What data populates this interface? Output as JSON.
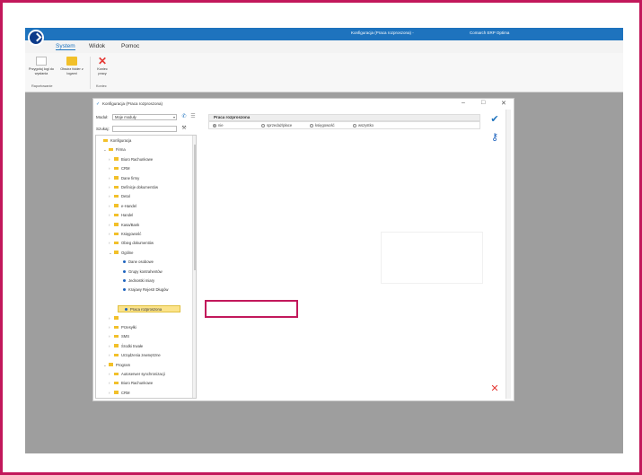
{
  "window": {
    "title": "Konfiguracja (Praca rozproszona) -",
    "app_name": "Comarch ERP Optima"
  },
  "ribbon": {
    "tabs": [
      {
        "label": "System",
        "active": true
      },
      {
        "label": "Widok",
        "active": false
      },
      {
        "label": "Pomoc",
        "active": false
      }
    ],
    "buttons": [
      {
        "label": "Przygotuj logi do wysłania",
        "icon": "document-icon"
      },
      {
        "label": "Otwórz folder z logami",
        "icon": "folder-icon"
      },
      {
        "label": "Koniec pracy",
        "icon": "close-icon"
      }
    ],
    "groups": [
      "Raportowanie",
      "Koniec"
    ]
  },
  "dialog": {
    "title": "Konfiguracja (Praca rozproszona)",
    "module_label": "Moduł:",
    "module_value": "Moje moduły",
    "search_label": "Szukaj:",
    "panel_title": "Praca rozproszona",
    "radio_options": [
      {
        "label": "nie",
        "selected": true
      },
      {
        "label": "sprzedaż/płace",
        "selected": false
      },
      {
        "label": "księgowość",
        "selected": false
      },
      {
        "label": "wszystko",
        "selected": false
      }
    ],
    "tree": [
      {
        "label": "Konfiguracja",
        "level": 0,
        "chev": "",
        "kind": "folder"
      },
      {
        "label": "Firma",
        "level": 1,
        "chev": "v",
        "kind": "folder"
      },
      {
        "label": "Biuro Rachunkowe",
        "level": 2,
        "chev": ">",
        "kind": "folder"
      },
      {
        "label": "CRM",
        "level": 2,
        "chev": ">",
        "kind": "folder"
      },
      {
        "label": "Dane firmy",
        "level": 2,
        "chev": ">",
        "kind": "folder"
      },
      {
        "label": "Definicje dokumentów",
        "level": 2,
        "chev": ">",
        "kind": "folder"
      },
      {
        "label": "Detal",
        "level": 2,
        "chev": ">",
        "kind": "folder"
      },
      {
        "label": "e-Handel",
        "level": 2,
        "chev": ">",
        "kind": "folder"
      },
      {
        "label": "Handel",
        "level": 2,
        "chev": ">",
        "kind": "folder"
      },
      {
        "label": "Kasa/Bank",
        "level": 2,
        "chev": ">",
        "kind": "folder"
      },
      {
        "label": "Księgowość",
        "level": 2,
        "chev": ">",
        "kind": "folder"
      },
      {
        "label": "Obieg dokumentów",
        "level": 2,
        "chev": ">",
        "kind": "folder"
      },
      {
        "label": "Ogólne",
        "level": 2,
        "chev": "v",
        "kind": "folder"
      },
      {
        "label": "Dane osobowe",
        "level": 3,
        "chev": "",
        "kind": "leaf"
      },
      {
        "label": "Grupy kontrahentów",
        "level": 3,
        "chev": "",
        "kind": "leaf"
      },
      {
        "label": "Jednostki miary",
        "level": 3,
        "chev": "",
        "kind": "leaf"
      },
      {
        "label": "Krajowy Rejestr Długów",
        "level": 3,
        "chev": "",
        "kind": "leaf"
      },
      {
        "label": "",
        "level": 3,
        "chev": "",
        "kind": "blank"
      },
      {
        "label": "Praca rozproszona",
        "level": 3,
        "chev": "",
        "kind": "leaf",
        "selected": true
      },
      {
        "label": "",
        "level": 2,
        "chev": ">",
        "kind": "folder"
      },
      {
        "label": "Przesyłki",
        "level": 2,
        "chev": ">",
        "kind": "folder"
      },
      {
        "label": "SMS",
        "level": 2,
        "chev": ">",
        "kind": "folder"
      },
      {
        "label": "Środki trwałe",
        "level": 2,
        "chev": ">",
        "kind": "folder"
      },
      {
        "label": "Urządzenia zewnętrzne",
        "level": 2,
        "chev": ">",
        "kind": "folder"
      },
      {
        "label": "Program",
        "level": 1,
        "chev": "v",
        "kind": "folder"
      },
      {
        "label": "Autoserwer synchronizacji",
        "level": 2,
        "chev": ">",
        "kind": "folder"
      },
      {
        "label": "Biuro Rachunkowe",
        "level": 2,
        "chev": ">",
        "kind": "folder"
      },
      {
        "label": "CRM",
        "level": 2,
        "chev": ">",
        "kind": "folder"
      }
    ]
  },
  "colors": {
    "titlebar": "#1e73be",
    "highlight_border": "#c2185b",
    "selected_row": "#fbe38a",
    "folder": "#f2c029"
  }
}
